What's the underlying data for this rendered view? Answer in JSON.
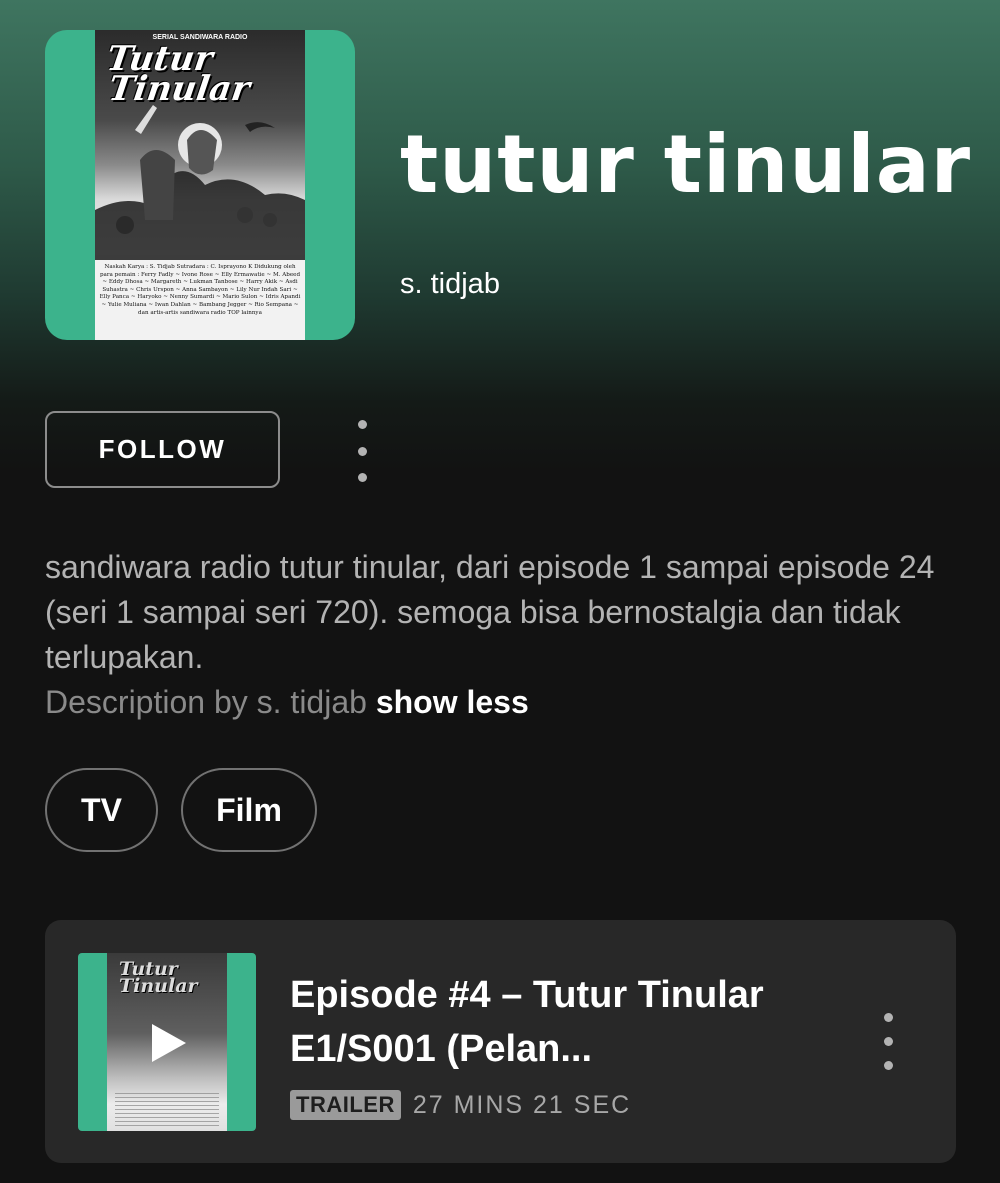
{
  "show": {
    "title": "tutur tinular",
    "author": "s. tidjab",
    "cover": {
      "subtitle": "SERIAL SANDIWARA RADIO",
      "title_line1": "Tutur",
      "title_line2": "Tinular",
      "credits": "Naskah Karya : S. Tidjab Sutradara : C. Isprayono K Didukung oleh para pemain : Ferry Fadly ~ Ivone Rose ~ Elly Ermawatie ~ M. Abeed ~ Eddy Dhosa ~ Margareth ~ Lukman Tanbose ~ Harry Akik ~ Asdi Suhastra ~ Chris Urspon ~ Anna Sambayon ~ Lily Nur Indah Sari ~ Elly Panca ~ Haryoko ~ Nenny Sumardi ~ Mario Sulon ~ Idris Apandi ~ Yulie Muliana ~ Iwan Dahlan ~ Bambang Jegger ~ Rio Sempana ~ dan artis-artis sandiwara radio TOP lainnya"
    }
  },
  "actions": {
    "follow_label": "FOLLOW"
  },
  "description": {
    "text": "sandiwara radio tutur tinular, dari episode 1 sampai episode 24 (seri 1 sampai seri 720). semoga bisa bernostalgia dan tidak terlupakan.",
    "by": "Description by s. tidjab",
    "toggle": "show less"
  },
  "categories": [
    "TV",
    "Film"
  ],
  "episode": {
    "title": "Episode #4 – Tutur Tinular E1/S001 (Pelan...",
    "badge": "TRAILER",
    "duration": "27 MINS 21 SEC",
    "thumb_title": "Tutur Tinular"
  },
  "colors": {
    "header_gradient_top": "#3f7560",
    "background": "#121212",
    "cover_green": "#3cb38c",
    "card_bg": "#282828"
  }
}
